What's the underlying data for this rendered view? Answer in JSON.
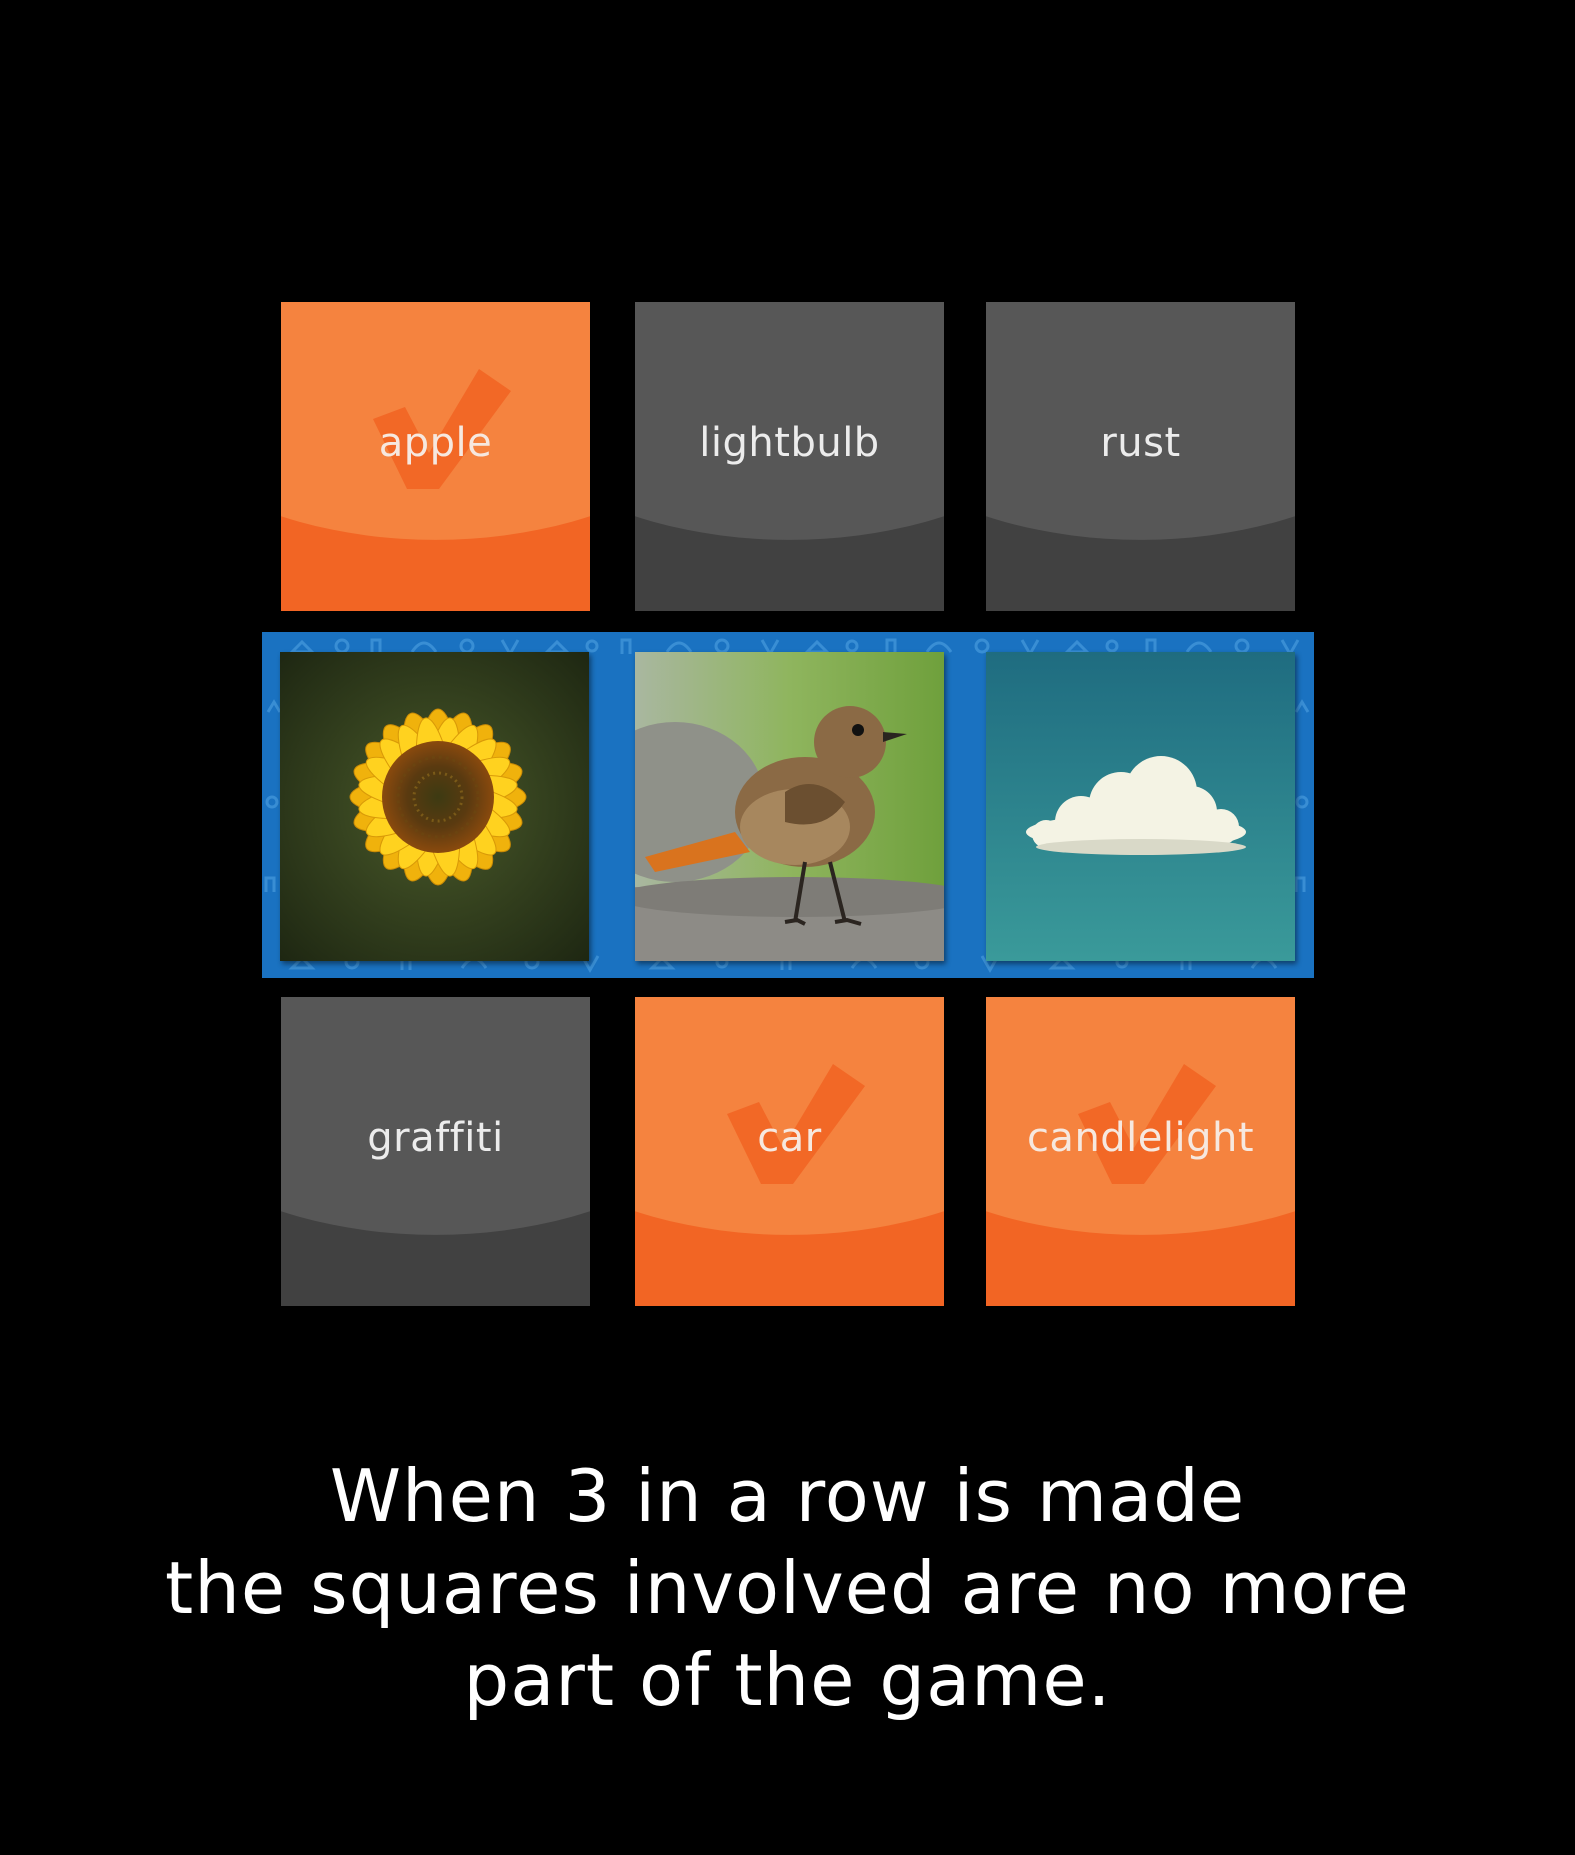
{
  "board": {
    "top_row": [
      {
        "word": "apple",
        "state": "checked",
        "color": "#f26524"
      },
      {
        "word": "lightbulb",
        "state": "unchecked",
        "color": "#575757"
      },
      {
        "word": "rust",
        "state": "unchecked",
        "color": "#575757"
      }
    ],
    "middle_row": {
      "strip_color": "#1a72c1",
      "images": [
        "sunflower",
        "bird",
        "cloud"
      ]
    },
    "bottom_row": [
      {
        "word": "graffiti",
        "state": "unchecked",
        "color": "#575757"
      },
      {
        "word": "car",
        "state": "checked",
        "color": "#f26524"
      },
      {
        "word": "candlelight",
        "state": "checked",
        "color": "#f26524"
      }
    ]
  },
  "caption": {
    "line1": "When 3 in a row is made",
    "line2": "the squares involved are no more",
    "line3": "part of the game."
  }
}
